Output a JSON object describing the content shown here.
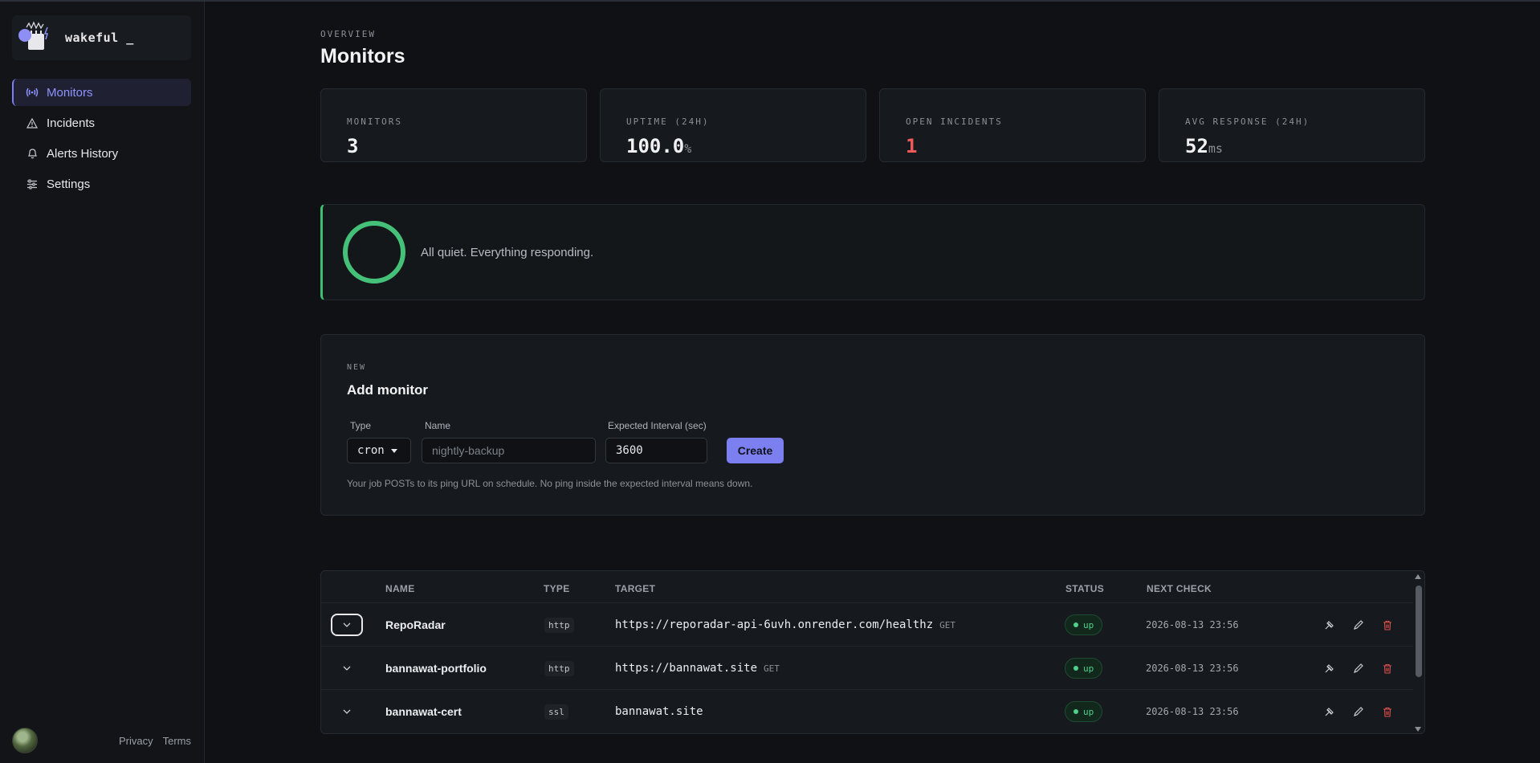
{
  "brand": {
    "name": "wakeful _"
  },
  "nav": {
    "items": [
      {
        "label": "Monitors",
        "icon": "pulse-icon",
        "active": true
      },
      {
        "label": "Incidents",
        "icon": "warning-triangle-icon"
      },
      {
        "label": "Alerts History",
        "icon": "bell-icon"
      },
      {
        "label": "Settings",
        "icon": "sliders-icon"
      }
    ]
  },
  "footer": {
    "privacy": "Privacy",
    "terms": "Terms"
  },
  "page": {
    "eyebrow": "OVERVIEW",
    "title": "Monitors"
  },
  "stats": [
    {
      "label": "MONITORS",
      "value": "3",
      "unit": ""
    },
    {
      "label": "UPTIME (24H)",
      "value": "100.0",
      "unit": "%"
    },
    {
      "label": "OPEN INCIDENTS",
      "value": "1",
      "unit": "",
      "color": "#ef5a5a"
    },
    {
      "label": "AVG RESPONSE (24H)",
      "value": "52",
      "unit": "ms"
    }
  ],
  "banner": {
    "message": "All quiet. Everything responding.",
    "status_color": "#45c078"
  },
  "add_monitor": {
    "eyebrow": "NEW",
    "title": "Add monitor",
    "type_label": "Type",
    "type_value": "cron",
    "name_label": "Name",
    "name_placeholder": "nightly-backup",
    "interval_label": "Expected Interval (sec)",
    "interval_value": "3600",
    "create_label": "Create",
    "help": "Your job POSTs to its ping URL on schedule. No ping inside the expected interval means down."
  },
  "table": {
    "headers": {
      "name": "NAME",
      "type": "TYPE",
      "target": "TARGET",
      "status": "STATUS",
      "next_check": "NEXT CHECK"
    },
    "rows": [
      {
        "name": "RepoRadar",
        "type": "http",
        "target": "https://reporadar-api-6uvh.onrender.com/healthz",
        "method": "GET",
        "status": "up",
        "next_check": "2026-08-13 23:56"
      },
      {
        "name": "bannawat-portfolio",
        "type": "http",
        "target": "https://bannawat.site",
        "method": "GET",
        "status": "up",
        "next_check": "2026-08-13 23:56"
      },
      {
        "name": "bannawat-cert",
        "type": "ssl",
        "target": "bannawat.site",
        "method": "",
        "status": "up",
        "next_check": "2026-08-13 23:56"
      }
    ]
  },
  "colors": {
    "accent": "#7c7ff0",
    "up": "#4fd18a",
    "danger": "#ef5a5a"
  }
}
